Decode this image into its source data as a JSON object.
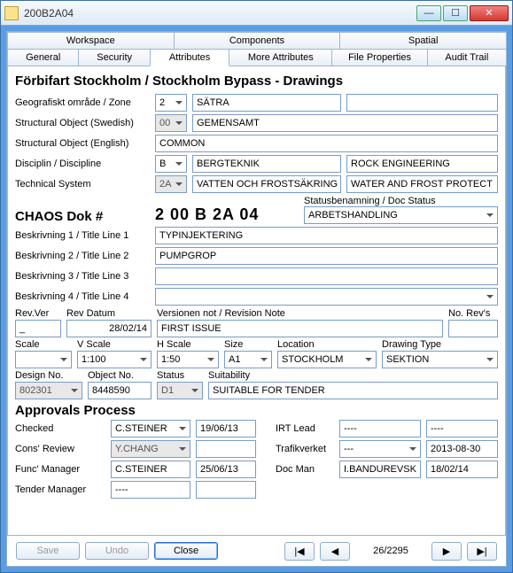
{
  "window": {
    "title": "200B2A04"
  },
  "tabs_row1": [
    "Workspace",
    "Components",
    "Spatial"
  ],
  "tabs_row2": [
    "General",
    "Security",
    "Attributes",
    "More Attributes",
    "File Properties",
    "Audit Trail"
  ],
  "active_tab": "Attributes",
  "page_title": "Förbifart Stockholm / Stockholm Bypass - Drawings",
  "zone": {
    "label": "Geografiskt område / Zone",
    "code": "2",
    "name": "SÄTRA"
  },
  "sobj_sv": {
    "label": "Structural Object (Swedish)",
    "code": "00",
    "name": "GEMENSAMT"
  },
  "sobj_en": {
    "label": "Structural Object (English)",
    "name": "COMMON"
  },
  "discipline": {
    "label": "Disciplin / Discipline",
    "code": "B",
    "name": "BERGTEKNIK",
    "en": "ROCK ENGINEERING"
  },
  "techsys": {
    "label": "Technical System",
    "code": "2A",
    "name": "VATTEN OCH FROSTSÄKRING",
    "en": "WATER AND FROST PROTECT"
  },
  "chaos": {
    "label": "CHAOS Dok #",
    "value": "2 00 B 2A 04"
  },
  "docstatus": {
    "label": "Statusbenamning / Doc Status",
    "value": "ARBETSHANDLING"
  },
  "title1": {
    "label": "Beskrivning 1 / Title Line 1",
    "value": "TYPINJEKTERING"
  },
  "title2": {
    "label": "Beskrivning 2 / Title Line 2",
    "value": "PUMPGROP"
  },
  "title3": {
    "label": "Beskrivning 3 / Title Line 3",
    "value": ""
  },
  "title4": {
    "label": "Beskrivning 4 / Title Line 4",
    "value": ""
  },
  "rev": {
    "ver_label": "Rev.Ver",
    "ver": "_",
    "date_label": "Rev Datum",
    "date": "28/02/14",
    "note_label": "Versionen not / Revision Note",
    "note": "FIRST ISSUE",
    "norev_label": "No. Rev's",
    "norev": ""
  },
  "scale": {
    "label": "Scale",
    "value": ""
  },
  "vscale": {
    "label": "V Scale",
    "value": "1:100"
  },
  "hscale": {
    "label": "H Scale",
    "value": "1:50"
  },
  "size": {
    "label": "Size",
    "value": "A1"
  },
  "location": {
    "label": "Location",
    "value": "STOCKHOLM"
  },
  "drawtype": {
    "label": "Drawing Type",
    "value": "SEKTION"
  },
  "design": {
    "label": "Design No.",
    "value": "802301"
  },
  "object": {
    "label": "Object No.",
    "value": "8448590"
  },
  "status": {
    "label": "Status",
    "value": "D1"
  },
  "suitability": {
    "label": "Suitability",
    "value": "SUITABLE FOR TENDER"
  },
  "approvals_title": "Approvals Process",
  "approvals": {
    "checked": {
      "label": "Checked",
      "who": "C.STEINER",
      "date": "19/06/13"
    },
    "cons": {
      "label": "Cons' Review",
      "who": "Y.CHANG",
      "date": ""
    },
    "func": {
      "label": "Func' Manager",
      "who": "C.STEINER",
      "date": "25/06/13"
    },
    "tender": {
      "label": "Tender Manager",
      "who": "----",
      "date": ""
    },
    "irt": {
      "label": "IRT Lead",
      "who": "----",
      "date": "----"
    },
    "trafik": {
      "label": "Trafikverket",
      "who": "---",
      "date": "2013-08-30"
    },
    "docman": {
      "label": "Doc Man",
      "who": "I.BANDUREVSK",
      "date": "18/02/14"
    }
  },
  "footer": {
    "save": "Save",
    "undo": "Undo",
    "close": "Close",
    "first": "|◀",
    "prev": "◀",
    "counter": "26/2295",
    "next": "▶",
    "last": "▶|"
  }
}
